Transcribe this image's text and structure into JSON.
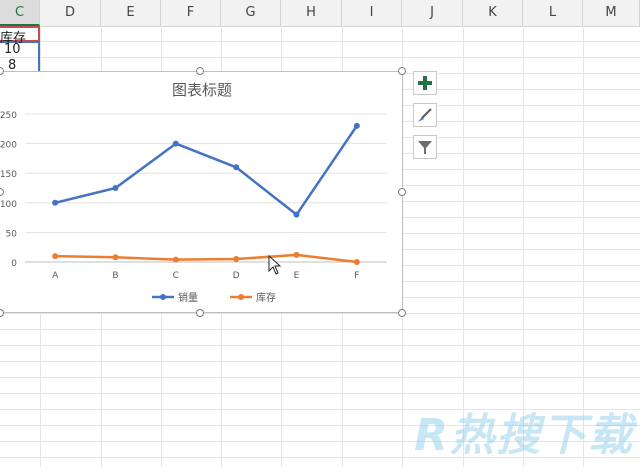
{
  "columns": [
    "C",
    "D",
    "E",
    "F",
    "G",
    "H",
    "I",
    "J",
    "K",
    "L",
    "M"
  ],
  "cells": {
    "header_label": "库存",
    "row1_value": "10",
    "row2_value": "8"
  },
  "chart_buttons": [
    "plus-icon",
    "brush-icon",
    "filter-icon"
  ],
  "watermark": "R热搜下载",
  "colors": {
    "sales": "#4472c4",
    "stock": "#ed7d31",
    "accent": "#217346"
  },
  "chart_data": {
    "type": "line",
    "title": "图表标题",
    "categories": [
      "A",
      "B",
      "C",
      "D",
      "E",
      "F"
    ],
    "yticks": [
      0,
      50,
      100,
      150,
      200,
      250
    ],
    "ylim": [
      0,
      250
    ],
    "legend_position": "bottom",
    "series": [
      {
        "name": "销量",
        "values": [
          100,
          125,
          200,
          160,
          80,
          230
        ]
      },
      {
        "name": "库存",
        "values": [
          10,
          8,
          4,
          5,
          12,
          0
        ]
      }
    ]
  }
}
